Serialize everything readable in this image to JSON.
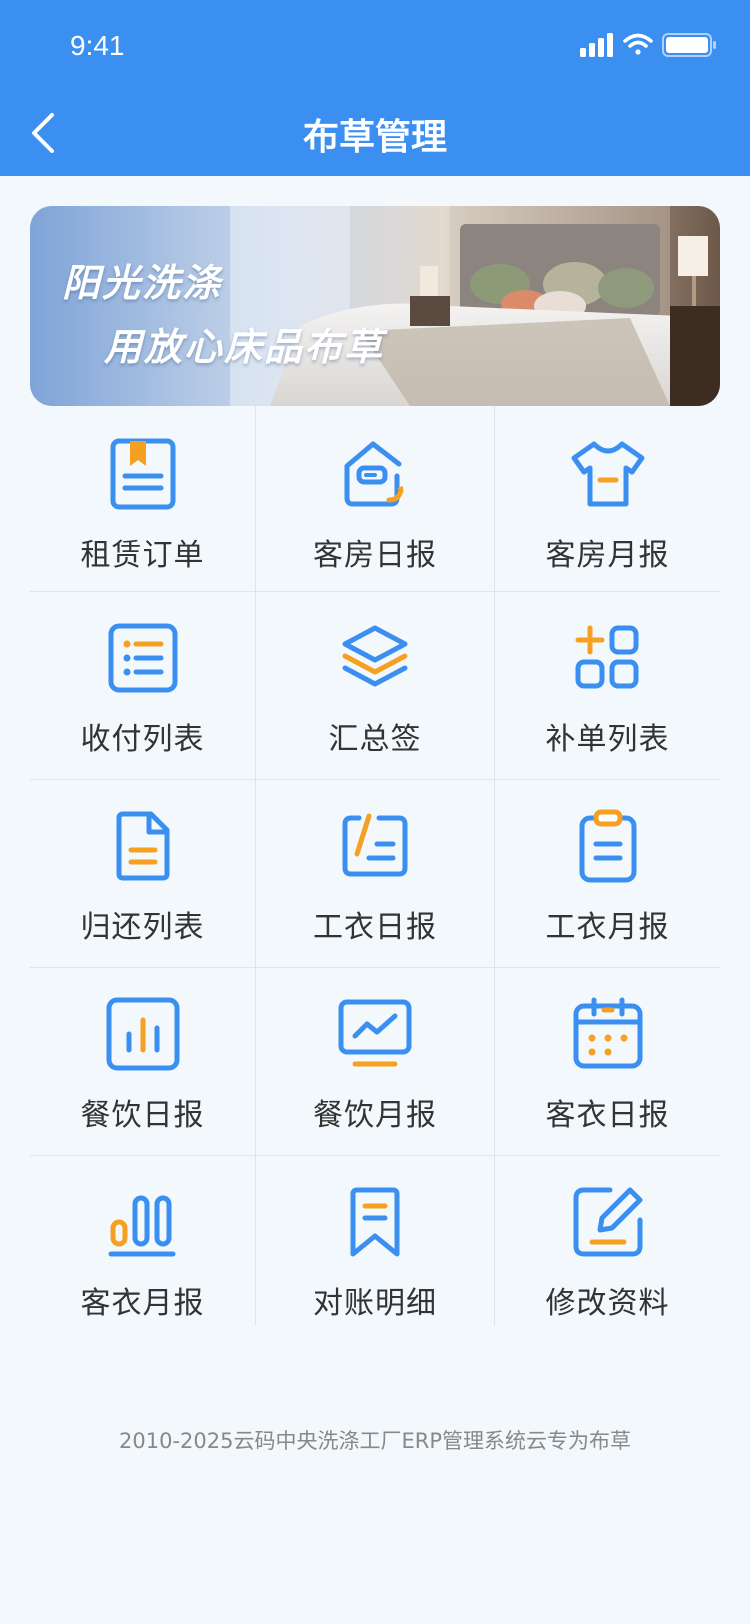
{
  "status_bar": {
    "time": "9:41"
  },
  "header": {
    "title": "布草管理"
  },
  "banner": {
    "line1": "阳光洗涤",
    "line2": "用放心床品布草"
  },
  "menu": [
    {
      "label": "租赁订单",
      "icon": "bookmark-document-icon"
    },
    {
      "label": "客房日报",
      "icon": "house-refresh-icon"
    },
    {
      "label": "客房月报",
      "icon": "t-shirt-icon"
    },
    {
      "label": "收付列表",
      "icon": "bullet-list-icon"
    },
    {
      "label": "汇总签",
      "icon": "layers-icon"
    },
    {
      "label": "补单列表",
      "icon": "add-grid-icon"
    },
    {
      "label": "归还列表",
      "icon": "file-icon"
    },
    {
      "label": "工衣日报",
      "icon": "edit-list-icon"
    },
    {
      "label": "工衣月报",
      "icon": "clipboard-icon"
    },
    {
      "label": "餐饮日报",
      "icon": "bar-chart-icon"
    },
    {
      "label": "餐饮月报",
      "icon": "monitor-chart-icon"
    },
    {
      "label": "客衣日报",
      "icon": "calendar-icon"
    },
    {
      "label": "客衣月报",
      "icon": "column-chart-icon"
    },
    {
      "label": "对账明细",
      "icon": "ribbon-bookmark-icon"
    },
    {
      "label": "修改资料",
      "icon": "pencil-edit-icon"
    }
  ],
  "footer": {
    "text": "2010-2025云码中央洗涤工厂ERP管理系统云专为布草"
  },
  "colors": {
    "primary": "#3b8ff0",
    "accent": "#f5a020",
    "background": "#f2f8fb"
  }
}
